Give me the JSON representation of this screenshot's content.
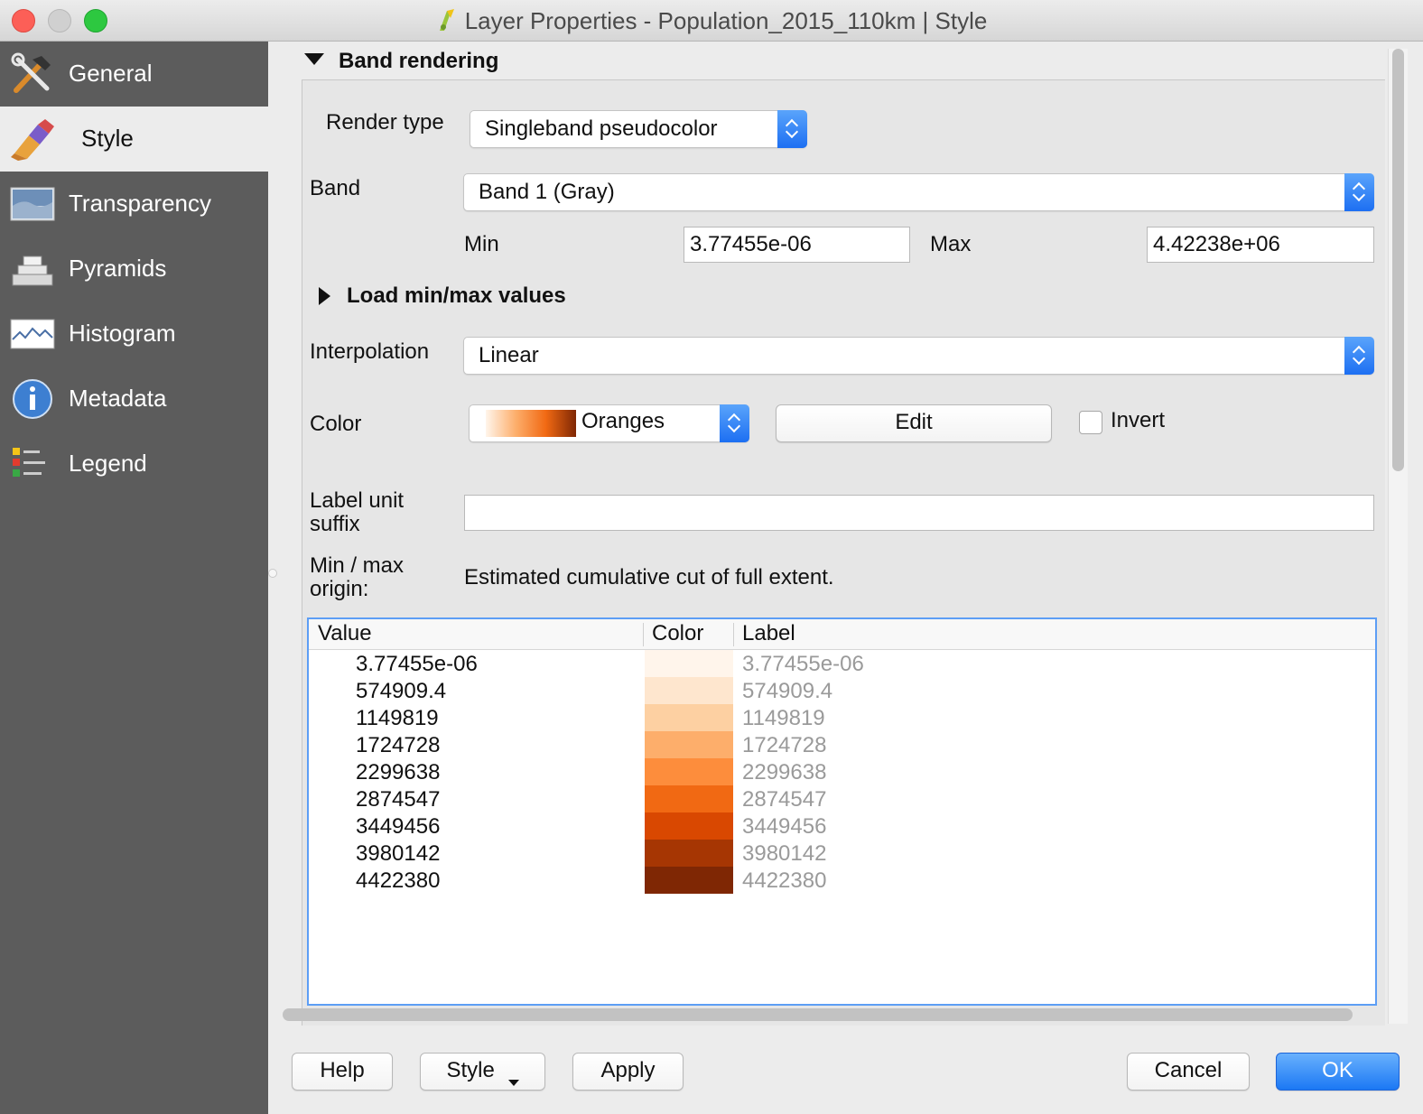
{
  "window": {
    "title": "Layer Properties - Population_2015_110km | Style"
  },
  "sidebar": {
    "items": [
      {
        "label": "General",
        "icon": "tools-icon"
      },
      {
        "label": "Style",
        "icon": "paintbrush-icon"
      },
      {
        "label": "Transparency",
        "icon": "transparency-icon"
      },
      {
        "label": "Pyramids",
        "icon": "pyramids-icon"
      },
      {
        "label": "Histogram",
        "icon": "histogram-icon"
      },
      {
        "label": "Metadata",
        "icon": "info-icon"
      },
      {
        "label": "Legend",
        "icon": "legend-icon"
      }
    ],
    "active": "Style"
  },
  "band_rendering": {
    "section_title": "Band rendering",
    "render_type_label": "Render type",
    "render_type_value": "Singleband pseudocolor",
    "band_label": "Band",
    "band_value": "Band 1 (Gray)",
    "min_label": "Min",
    "min_value": "3.77455e-06",
    "max_label": "Max",
    "max_value": "4.42238e+06",
    "load_minmax_label": "Load min/max values",
    "interpolation_label": "Interpolation",
    "interpolation_value": "Linear",
    "color_label": "Color",
    "color_ramp_value": "Oranges",
    "edit_label": "Edit",
    "invert_label": "Invert",
    "invert_checked": false,
    "label_unit_suffix_line1": "Label unit",
    "label_unit_suffix_line2": "suffix",
    "label_unit_suffix_value": "",
    "minmax_origin_line1": "Min / max",
    "minmax_origin_line2": "origin:",
    "minmax_origin_value": "Estimated cumulative cut of full extent."
  },
  "color_table": {
    "headers": {
      "value": "Value",
      "color": "Color",
      "label": "Label"
    },
    "rows": [
      {
        "value": "3.77455e-06",
        "color": "#fff5eb",
        "label": "3.77455e-06"
      },
      {
        "value": "574909.4",
        "color": "#fee6ce",
        "label": "574909.4"
      },
      {
        "value": "1149819",
        "color": "#fdd0a2",
        "label": "1149819"
      },
      {
        "value": "1724728",
        "color": "#fdae6b",
        "label": "1724728"
      },
      {
        "value": "2299638",
        "color": "#fd8d3c",
        "label": "2299638"
      },
      {
        "value": "2874547",
        "color": "#f16913",
        "label": "2874547"
      },
      {
        "value": "3449456",
        "color": "#d94801",
        "label": "3449456"
      },
      {
        "value": "3980142",
        "color": "#a63603",
        "label": "3980142"
      },
      {
        "value": "4422380",
        "color": "#7f2704",
        "label": "4422380"
      }
    ]
  },
  "buttons": {
    "help": "Help",
    "style": "Style",
    "apply": "Apply",
    "cancel": "Cancel",
    "ok": "OK"
  },
  "colors": {
    "sidebar_bg": "#5c5c5c",
    "accent_blue": "#1b78f4",
    "table_border": "#5d9ef5"
  }
}
